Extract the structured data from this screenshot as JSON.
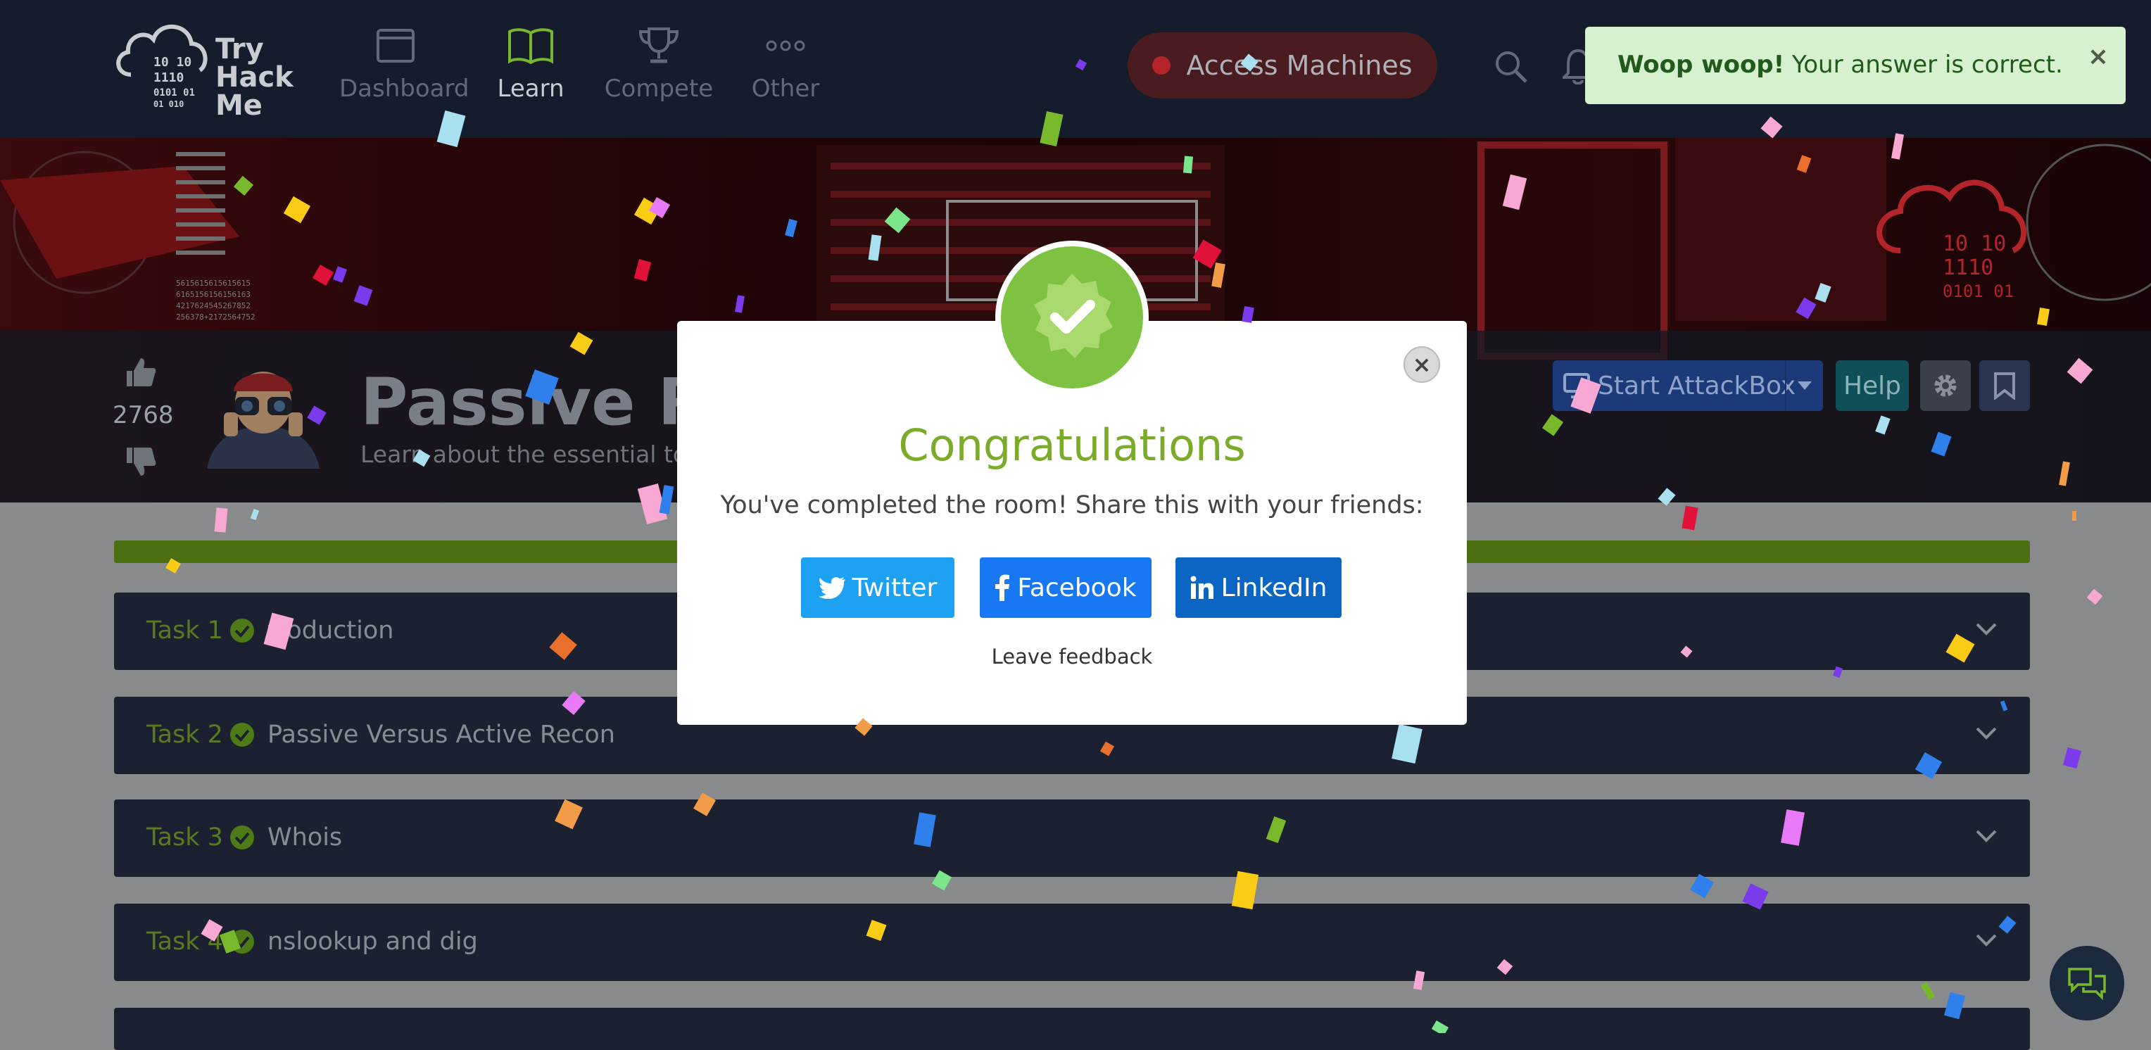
{
  "nav": {
    "logo": "Try Hack Me",
    "items": [
      {
        "label": "Dashboard",
        "icon": "dashboard-icon",
        "active": false
      },
      {
        "label": "Learn",
        "icon": "book-icon",
        "active": true
      },
      {
        "label": "Compete",
        "icon": "trophy-icon",
        "active": false
      },
      {
        "label": "Other",
        "icon": "more-icon",
        "active": false
      }
    ],
    "access_button": "Access Machines",
    "search_icon": "search-icon",
    "bell_icon": "bell-icon"
  },
  "room": {
    "likes": "2768",
    "title": "Passive Rec",
    "subtitle": "Learn about the essential to",
    "attackbox_label": "Start AttackBox",
    "help_label": "Help"
  },
  "tasks": [
    {
      "num": "Task 1",
      "title": "troduction"
    },
    {
      "num": "Task 2",
      "title": "Passive Versus Active Recon"
    },
    {
      "num": "Task 3",
      "title": "Whois"
    },
    {
      "num": "Task 4",
      "title": "nslookup and dig"
    }
  ],
  "modal": {
    "title": "Congratulations",
    "message": "You've completed the room! Share this with your friends:",
    "twitter": "Twitter",
    "facebook": "Facebook",
    "linkedin": "LinkedIn",
    "feedback": "Leave feedback"
  },
  "toast": {
    "strong": "Woop woop!",
    "message": " Your answer is correct."
  },
  "colors": {
    "accent_green": "#7aac2a",
    "nav_bg": "#151c2b",
    "twitter": "#1da1f2",
    "facebook": "#1877f2",
    "linkedin": "#0a66c2",
    "toast_bg": "#d7f0d0"
  }
}
